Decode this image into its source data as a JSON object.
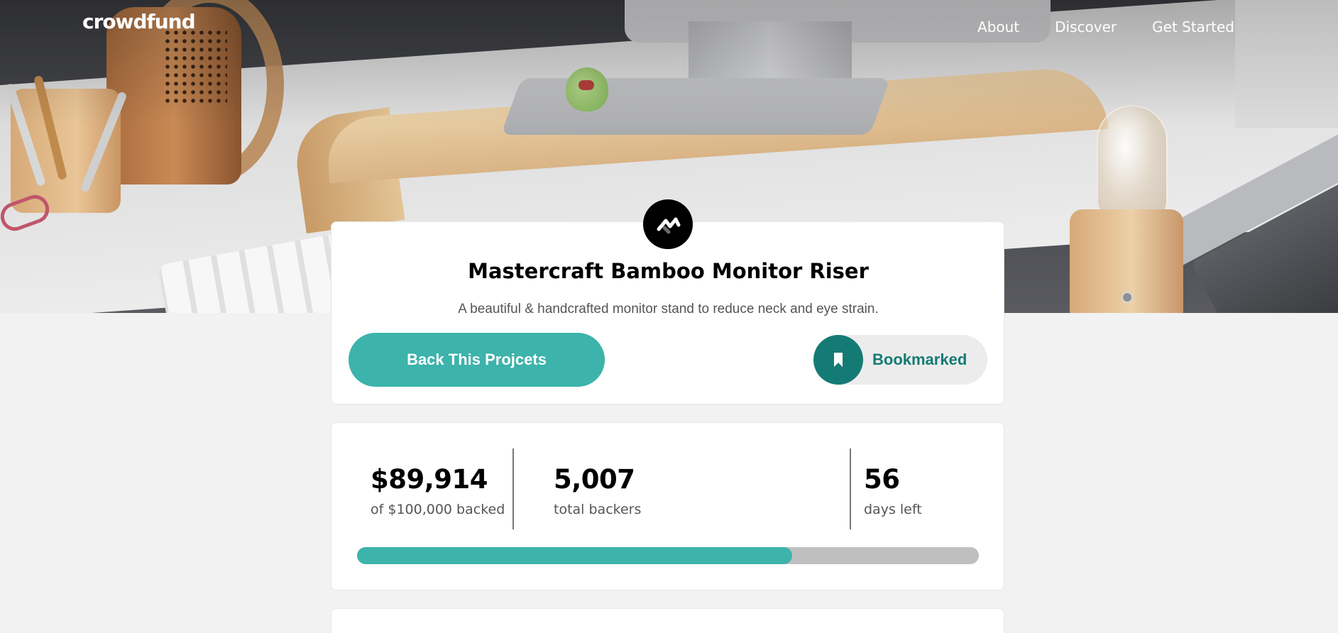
{
  "nav": {
    "logo": "crowdfund",
    "links": [
      "About",
      "Discover",
      "Get Started"
    ]
  },
  "project": {
    "title": "Mastercraft Bamboo Monitor Riser",
    "description": "A beautiful & handcrafted monitor stand to reduce neck and eye strain.",
    "back_button": "Back This Projcets",
    "bookmark_button": "Bookmarked"
  },
  "stats": {
    "backed": {
      "value": "$89,914",
      "label": "of $100,000 backed"
    },
    "backers": {
      "value": "5,007",
      "label": "total backers"
    },
    "days": {
      "value": "56",
      "label": "days left"
    },
    "progress_fraction": 0.7
  },
  "colors": {
    "accent": "#3cb3ab",
    "accent_dark": "#147b74",
    "track": "#bfbfbf",
    "page_bg": "#f2f2f2"
  },
  "icons": {
    "logo_mark": "mastercraft-logo-icon",
    "bookmark": "bookmark-icon"
  }
}
